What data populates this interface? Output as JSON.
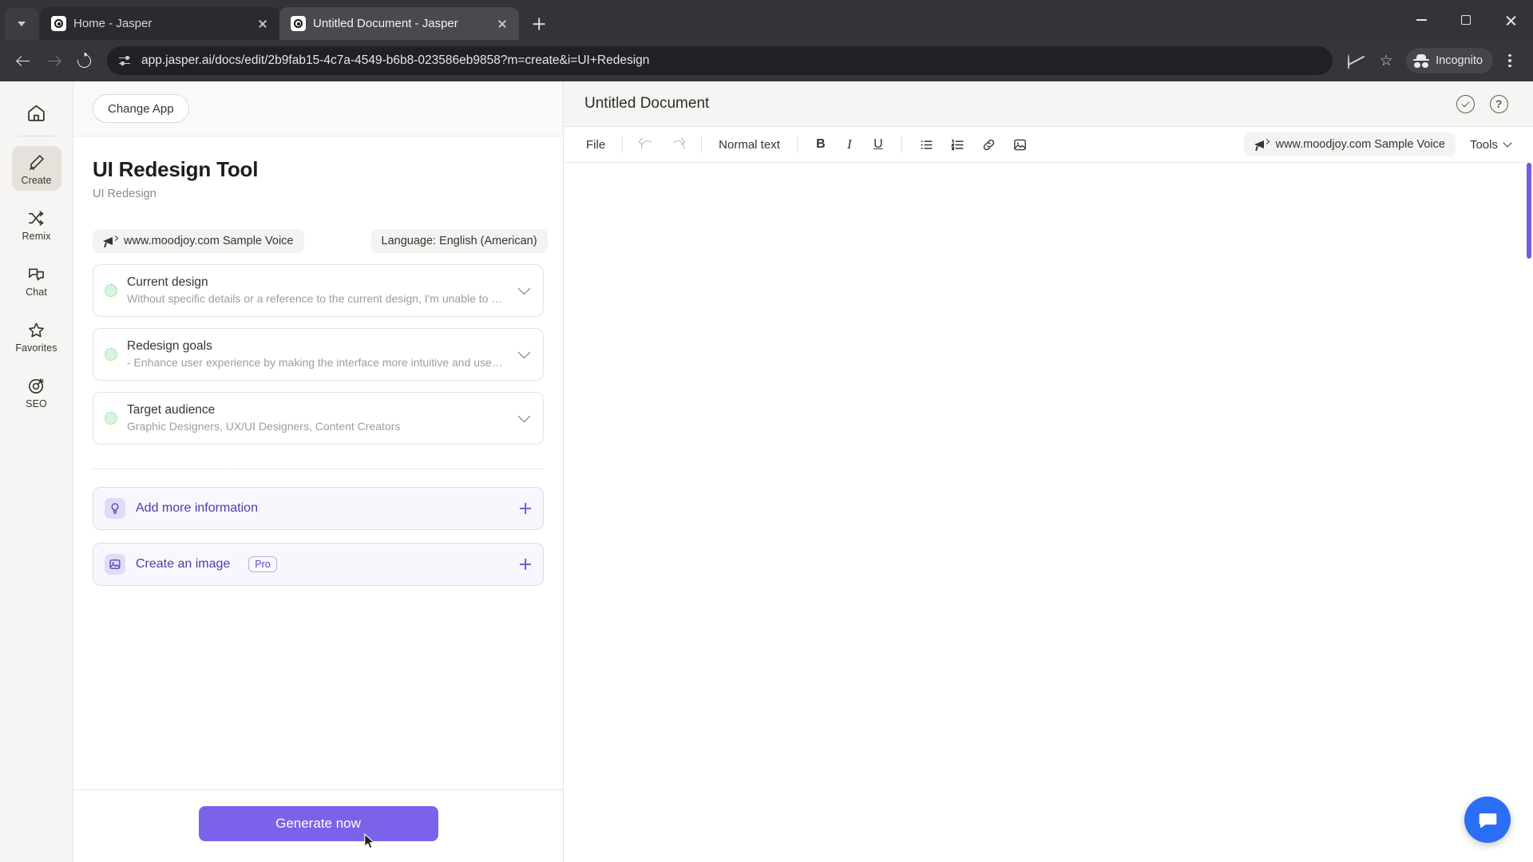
{
  "browser": {
    "tabs": [
      {
        "title": "Home - Jasper",
        "active": false,
        "favicon": "jasper-favicon"
      },
      {
        "title": "Untitled Document - Jasper",
        "active": true,
        "favicon": "jasper-favicon"
      }
    ],
    "url": "app.jasper.ai/docs/edit/2b9fab15-4c7a-4549-b6b8-023586eb9858?m=create&i=UI+Redesign",
    "profile_label": "Incognito",
    "icons": {
      "tab_list": "chevron-down-icon",
      "new_tab": "new-tab-icon",
      "back": "back-arrow-icon",
      "forward": "forward-arrow-icon",
      "reload": "reload-icon",
      "site_info": "site-settings-icon",
      "tracking": "third-party-cookies-blocked-icon",
      "bookmark": "bookmark-star-icon",
      "menu": "browser-menu-icon",
      "minimize": "window-minimize-icon",
      "maximize": "window-maximize-icon",
      "close": "window-close-icon"
    }
  },
  "rail": {
    "home_icon": "home-icon",
    "items": [
      {
        "label": "Create",
        "icon": "pencil-icon",
        "active": true
      },
      {
        "label": "Remix",
        "icon": "shuffle-icon",
        "active": false
      },
      {
        "label": "Chat",
        "icon": "chat-bubbles-icon",
        "active": false
      },
      {
        "label": "Favorites",
        "icon": "star-icon",
        "active": false
      },
      {
        "label": "SEO",
        "icon": "target-icon",
        "active": false
      }
    ]
  },
  "left_panel": {
    "change_app_label": "Change App",
    "title": "UI Redesign Tool",
    "subtitle": "UI Redesign",
    "voice_chip": "www.moodjoy.com Sample Voice",
    "language_chip": "Language: English (American)",
    "fields": [
      {
        "title": "Current design",
        "description": "Without specific details or a reference to the current design, I'm unable to p..."
      },
      {
        "title": "Redesign goals",
        "description": "- Enhance user experience by making the interface more intuitive and user-f..."
      },
      {
        "title": "Target audience",
        "description": "Graphic Designers, UX/UI Designers, Content Creators"
      }
    ],
    "add_more_information": "Add more information",
    "create_an_image": "Create an image",
    "pro_badge": "Pro",
    "generate_label": "Generate now"
  },
  "editor": {
    "document_title": "Untitled Document",
    "header_icons": [
      {
        "name": "saved-check-icon"
      },
      {
        "name": "help-question-icon"
      }
    ],
    "toolbar": {
      "file_label": "File",
      "undo_icon": "undo-icon",
      "redo_icon": "redo-icon",
      "text_style": "Normal text",
      "bold_label": "B",
      "italic_label": "I",
      "underline_label": "U",
      "bullet_list_icon": "bullet-list-icon",
      "numbered_list_icon": "numbered-list-icon",
      "link_icon": "link-icon",
      "image_icon": "image-icon",
      "voice_chip": "www.moodjoy.com Sample Voice",
      "tools_label": "Tools"
    },
    "body_text": "",
    "support_bubble_icon": "message-bubble-icon"
  },
  "colors": {
    "accent_purple": "#7c62e8",
    "chip_purple_bg": "#f8f7fd",
    "chat_blue": "#2b6ef6",
    "green_dot": "#d6f5de"
  }
}
